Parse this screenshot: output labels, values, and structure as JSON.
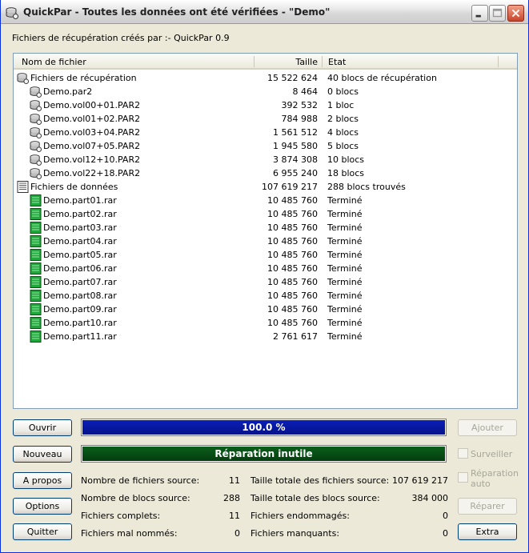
{
  "window": {
    "title": "QuickPar - Toutes les données ont été vérifiées - \"Demo\""
  },
  "created_by": "Fichiers de récupération créés par :- QuickPar 0.9",
  "list": {
    "columns": {
      "name": "Nom de fichier",
      "size": "Taille",
      "state": "Etat"
    },
    "rows": [
      {
        "name": "Fichiers de récupération",
        "size": "15 522 624",
        "state": "40 blocs de récupération",
        "kind": "group-par",
        "icon": "par-files-icon"
      },
      {
        "name": "Demo.par2",
        "size": "8 464",
        "state": "0 blocs",
        "kind": "par",
        "icon": "par-file-icon"
      },
      {
        "name": "Demo.vol00+01.PAR2",
        "size": "392 532",
        "state": "1 bloc",
        "kind": "par",
        "icon": "par-file-icon"
      },
      {
        "name": "Demo.vol01+02.PAR2",
        "size": "784 988",
        "state": "2 blocs",
        "kind": "par",
        "icon": "par-file-icon"
      },
      {
        "name": "Demo.vol03+04.PAR2",
        "size": "1 561 512",
        "state": "4 blocs",
        "kind": "par",
        "icon": "par-file-icon"
      },
      {
        "name": "Demo.vol07+05.PAR2",
        "size": "1 945 580",
        "state": "5 blocs",
        "kind": "par",
        "icon": "par-file-icon"
      },
      {
        "name": "Demo.vol12+10.PAR2",
        "size": "3 874 308",
        "state": "10 blocs",
        "kind": "par",
        "icon": "par-file-icon"
      },
      {
        "name": "Demo.vol22+18.PAR2",
        "size": "6 955 240",
        "state": "18 blocs",
        "kind": "par",
        "icon": "par-file-icon"
      },
      {
        "name": "Fichiers de données",
        "size": "107 619 217",
        "state": "288 blocs trouvés",
        "kind": "group-data",
        "icon": "data-files-icon"
      },
      {
        "name": "Demo.part01.rar",
        "size": "10 485 760",
        "state": "Terminé",
        "kind": "data",
        "icon": "complete-file-icon"
      },
      {
        "name": "Demo.part02.rar",
        "size": "10 485 760",
        "state": "Terminé",
        "kind": "data",
        "icon": "complete-file-icon"
      },
      {
        "name": "Demo.part03.rar",
        "size": "10 485 760",
        "state": "Terminé",
        "kind": "data",
        "icon": "complete-file-icon"
      },
      {
        "name": "Demo.part04.rar",
        "size": "10 485 760",
        "state": "Terminé",
        "kind": "data",
        "icon": "complete-file-icon"
      },
      {
        "name": "Demo.part05.rar",
        "size": "10 485 760",
        "state": "Terminé",
        "kind": "data",
        "icon": "complete-file-icon"
      },
      {
        "name": "Demo.part06.rar",
        "size": "10 485 760",
        "state": "Terminé",
        "kind": "data",
        "icon": "complete-file-icon"
      },
      {
        "name": "Demo.part07.rar",
        "size": "10 485 760",
        "state": "Terminé",
        "kind": "data",
        "icon": "complete-file-icon"
      },
      {
        "name": "Demo.part08.rar",
        "size": "10 485 760",
        "state": "Terminé",
        "kind": "data",
        "icon": "complete-file-icon"
      },
      {
        "name": "Demo.part09.rar",
        "size": "10 485 760",
        "state": "Terminé",
        "kind": "data",
        "icon": "complete-file-icon"
      },
      {
        "name": "Demo.part10.rar",
        "size": "10 485 760",
        "state": "Terminé",
        "kind": "data",
        "icon": "complete-file-icon"
      },
      {
        "name": "Demo.part11.rar",
        "size": "2 761 617",
        "state": "Terminé",
        "kind": "data",
        "icon": "complete-file-icon"
      }
    ]
  },
  "buttons": {
    "open": "Ouvrir",
    "new": "Nouveau",
    "about": "A propos",
    "options": "Options",
    "quit": "Quitter",
    "add": "Ajouter",
    "repair": "Réparer",
    "extra": "Extra"
  },
  "checkboxes": {
    "watch": "Surveiller",
    "auto_repair_line1": "Réparation",
    "auto_repair_line2": "auto"
  },
  "progress": {
    "verify_label": "100.0 %",
    "verify_fraction": 1.0,
    "repair_label": "Réparation inutile",
    "repair_fraction": 1.0
  },
  "stats": {
    "source_files_label": "Nombre de fichiers source:",
    "source_files_value": "11",
    "source_blocks_label": "Nombre de blocs source:",
    "source_blocks_value": "288",
    "complete_files_label": "Fichiers complets:",
    "complete_files_value": "11",
    "misnamed_files_label": "Fichiers mal nommés:",
    "misnamed_files_value": "0",
    "total_source_size_label": "Taille totale des fichiers source:",
    "total_source_size_value": "107 619 217",
    "total_block_size_label": "Taille totale des blocs source:",
    "total_block_size_value": "384 000",
    "damaged_files_label": "Fichiers endommagés:",
    "damaged_files_value": "0",
    "missing_files_label": "Fichiers manquants:",
    "missing_files_value": "0"
  },
  "colors": {
    "progress_blue": "#0a1fb5",
    "progress_green": "#0b5f1b",
    "file_green": "#1fa83c"
  }
}
